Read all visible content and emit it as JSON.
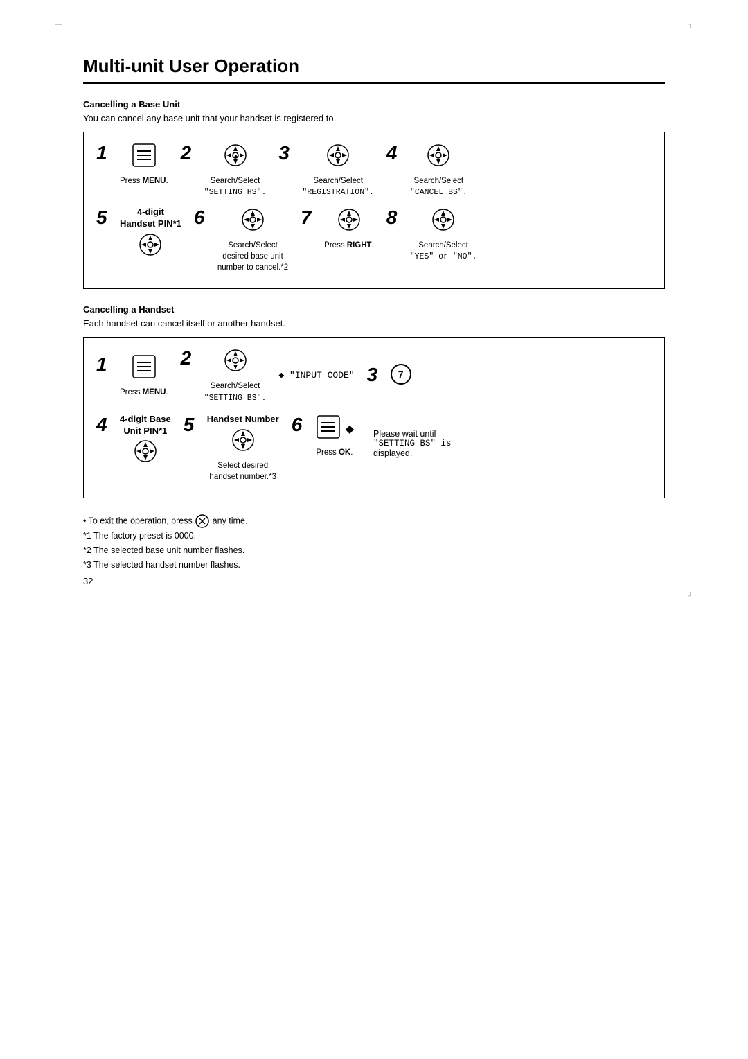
{
  "page": {
    "title": "Multi-unit User Operation",
    "page_number": "32",
    "corner_tl": "—",
    "corner_tr": "┐",
    "corner_br": "┘"
  },
  "section1": {
    "title": "Cancelling a Base Unit",
    "description": "You can cancel any base unit that your handset is registered to.",
    "steps_row1": [
      {
        "number": "1",
        "icon": "menu-button",
        "label": "Press MENU",
        "label_bold": "MENU"
      },
      {
        "number": "2",
        "icon": "nav-button",
        "label": "Search/Select",
        "label2": "\"SETTING HS\"."
      },
      {
        "number": "3",
        "icon": "nav-button",
        "label": "Search/Select",
        "label2": "\"REGISTRATION\"."
      },
      {
        "number": "4",
        "icon": "nav-button",
        "label": "Search/Select",
        "label2": "\"CANCEL BS\"."
      }
    ],
    "steps_row2": [
      {
        "number": "5",
        "label_main": "4-digit",
        "label_sub": "Handset PIN*1",
        "icon": "nav-button"
      },
      {
        "number": "6",
        "icon": "nav-button",
        "label": "Search/Select",
        "label2": "desired base unit",
        "label3": "number to cancel.*2"
      },
      {
        "number": "7",
        "icon": "nav-button",
        "label": "Press RIGHT",
        "label_bold": "RIGHT"
      },
      {
        "number": "8",
        "icon": "nav-button",
        "label": "Search/Select",
        "label2": "\"YES\" or \"NO\"."
      }
    ]
  },
  "section2": {
    "title": "Cancelling a Handset",
    "description": "Each handset can cancel itself or another handset.",
    "row1": [
      {
        "number": "1",
        "icon": "menu-button",
        "label": "Press MENU",
        "label_bold": "MENU"
      },
      {
        "number": "2",
        "icon": "nav-button",
        "label": "Search/Select",
        "label2": "\"SETTING BS\"."
      },
      {
        "arrow_label": "◆ \"INPUT CODE\""
      },
      {
        "number": "3",
        "icon": "circle-7"
      }
    ],
    "row2": [
      {
        "number": "4",
        "label_main": "4-digit Base",
        "label_sub": "Unit PIN*1",
        "icon": "nav-button"
      },
      {
        "number": "5",
        "label_main": "Handset Number",
        "icon": "nav-button",
        "label2": "Select desired",
        "label3": "handset number.*3"
      },
      {
        "number": "6",
        "icon": "menu-button",
        "arrow": "◆",
        "label": "Press OK",
        "label_bold": "OK"
      }
    ],
    "row2_right": {
      "label1": "Please wait until",
      "label2": "\"SETTING BS\" is",
      "label3": "displayed."
    }
  },
  "notes": {
    "bullet": "• To exit the operation, press  any time.",
    "footnote1": "*1 The factory preset is 0000.",
    "footnote2": "*2 The selected base unit number flashes.",
    "footnote3": "*3 The selected handset number flashes."
  }
}
